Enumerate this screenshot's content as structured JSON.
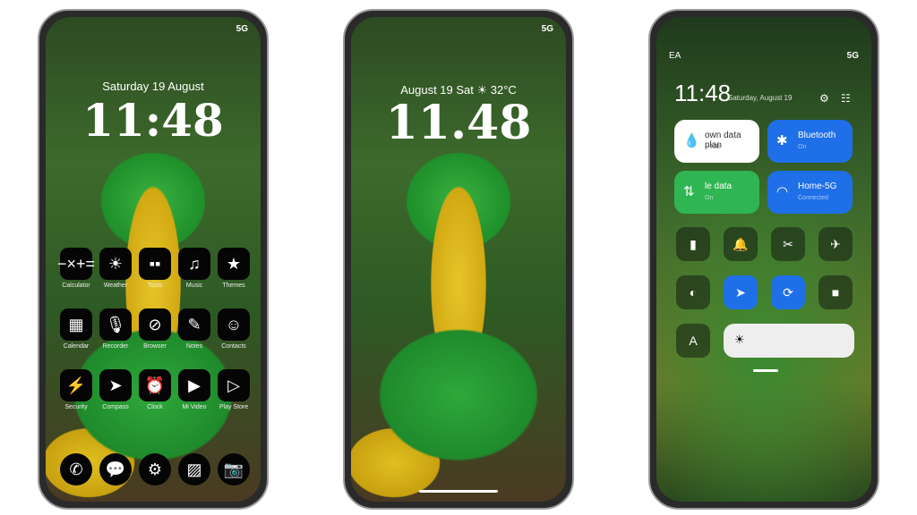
{
  "phone1": {
    "status": "5G",
    "date": "Saturday 19 August",
    "time": "11:48",
    "apps": [
      {
        "label": "Calculator",
        "icon": "−×+="
      },
      {
        "label": "Weather",
        "icon": "☀"
      },
      {
        "label": "Tools",
        "icon": "▪▪"
      },
      {
        "label": "Music",
        "icon": "♫"
      },
      {
        "label": "Themes",
        "icon": "★"
      },
      {
        "label": "Calendar",
        "icon": "▦"
      },
      {
        "label": "Recorder",
        "icon": "🎙"
      },
      {
        "label": "Browser",
        "icon": "⊘"
      },
      {
        "label": "Notes",
        "icon": "✎"
      },
      {
        "label": "Contacts",
        "icon": "☺"
      },
      {
        "label": "Security",
        "icon": "⚡"
      },
      {
        "label": "Compass",
        "icon": "➤"
      },
      {
        "label": "Clock",
        "icon": "⏰"
      },
      {
        "label": "Mi Video",
        "icon": "▶"
      },
      {
        "label": "Play Store",
        "icon": "▷"
      }
    ],
    "dock": [
      {
        "name": "phone",
        "icon": "✆"
      },
      {
        "name": "messages",
        "icon": "💬"
      },
      {
        "name": "settings",
        "icon": "⚙"
      },
      {
        "name": "gallery",
        "icon": "▨"
      },
      {
        "name": "camera",
        "icon": "📷"
      }
    ]
  },
  "phone2": {
    "status": "5G",
    "date": "August 19 Sat ☀ 32°C",
    "time": "11.48"
  },
  "phone3": {
    "carrier": "EA",
    "status": "5G",
    "time": "11:48",
    "date": "Saturday, August 19",
    "tiles": [
      {
        "title": "own data plan",
        "sub": "-- MB",
        "icon": "💧"
      },
      {
        "title": "Bluetooth",
        "sub": "On",
        "icon": "✱"
      },
      {
        "title": "le data",
        "sub": "On",
        "icon": "⇅"
      },
      {
        "title": "Home-5G",
        "sub": "Connected",
        "icon": "◠"
      }
    ],
    "toggles": [
      {
        "name": "flashlight",
        "icon": "▮",
        "on": false
      },
      {
        "name": "notifications",
        "icon": "🔔",
        "on": false
      },
      {
        "name": "screenshot",
        "icon": "✂",
        "on": false
      },
      {
        "name": "airplane",
        "icon": "✈",
        "on": false
      },
      {
        "name": "dark-mode",
        "icon": "◐",
        "on": false
      },
      {
        "name": "location",
        "icon": "➤",
        "on": true
      },
      {
        "name": "rotation-lock",
        "icon": "⟳",
        "on": true
      },
      {
        "name": "screen-record",
        "icon": "■",
        "on": false
      }
    ],
    "font_label": "A",
    "brightness_icon": "☀"
  },
  "colors": {
    "accent": "#1f6fe8",
    "green": "#2fb552"
  }
}
